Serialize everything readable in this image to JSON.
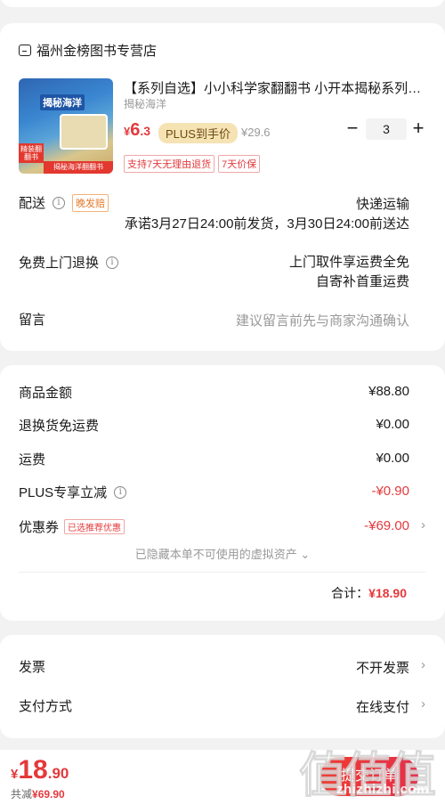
{
  "shop": {
    "name": "福州金榜图书专营店"
  },
  "product": {
    "title": "【系列自选】小小科学家翻翻书 小开本揭秘系列…",
    "subtitle": "揭秘海洋",
    "price_currency": "¥",
    "price_int": "6",
    "price_dec": ".3",
    "plus_label": "PLUS到手价",
    "original_price": "¥29.6",
    "quantity": "3",
    "tags": [
      "支持7天无理由退货",
      "7天价保"
    ],
    "thumb_title": "揭秘海洋",
    "thumb_badge": "精装翻翻书",
    "thumb_foot": "揭秘海洋翻翻书"
  },
  "delivery": {
    "label": "配送",
    "late_tag": "晚发赔",
    "method": "快递运输",
    "promise": "承诺3月27日24:00前发货，3月30日24:00前送达"
  },
  "return_service": {
    "label": "免费上门退换",
    "line1": "上门取件享运费全免",
    "line2": "自寄补首重运费"
  },
  "message": {
    "label": "留言",
    "placeholder": "建议留言前先与商家沟通确认"
  },
  "summary": {
    "goods_label": "商品金额",
    "goods_value": "¥88.80",
    "return_ship_label": "退换货免运费",
    "return_ship_value": "¥0.00",
    "ship_label": "运费",
    "ship_value": "¥0.00",
    "plus_label": "PLUS专享立减",
    "plus_value": "-¥0.90",
    "coupon_label": "优惠券",
    "coupon_tag": "已选推荐优惠",
    "coupon_value": "-¥69.00",
    "hidden_note": "已隐藏本单不可使用的虚拟资产 ⌄",
    "total_label": "合计：",
    "total_value": "¥18.90"
  },
  "invoice": {
    "label": "发票",
    "value": "不开发票"
  },
  "payment": {
    "label": "支付方式",
    "value": "在线支付"
  },
  "footer": {
    "currency": "¥",
    "int": "18",
    "dec": ".90",
    "save_label": "共减",
    "save_value": "¥69.90",
    "submit_label": "提交订单"
  },
  "watermark": {
    "text": "值值值",
    "url": "zhizhizhi.com"
  },
  "colors": {
    "accent": "#e4393c",
    "plus_bg": "#f6e3b4",
    "page_bg": "#f2f2f2"
  }
}
